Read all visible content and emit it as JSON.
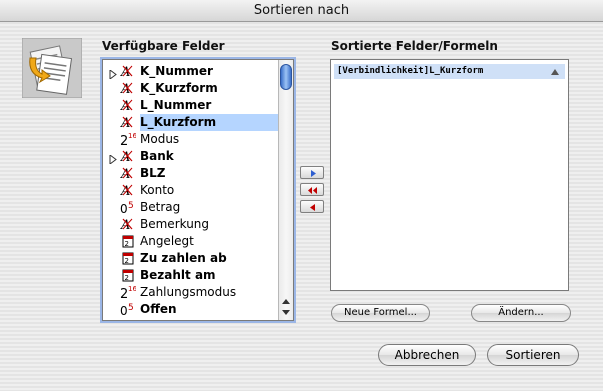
{
  "window": {
    "title": "Sortieren nach"
  },
  "fields": {
    "heading": "Verfügbare Felder",
    "items": [
      {
        "label": "K_Nummer",
        "icon": "A",
        "bold": true,
        "expandable": true,
        "selected": false
      },
      {
        "label": "K_Kurzform",
        "icon": "A",
        "bold": true,
        "expandable": false,
        "selected": false
      },
      {
        "label": "L_Nummer",
        "icon": "A",
        "bold": true,
        "expandable": false,
        "selected": false
      },
      {
        "label": "L_Kurzform",
        "icon": "A",
        "bold": true,
        "expandable": false,
        "selected": true
      },
      {
        "label": "Modus",
        "icon": "2¹⁶",
        "bold": false,
        "expandable": false,
        "selected": false
      },
      {
        "label": "Bank",
        "icon": "A",
        "bold": true,
        "expandable": true,
        "selected": false
      },
      {
        "label": "BLZ",
        "icon": "A",
        "bold": true,
        "expandable": false,
        "selected": false
      },
      {
        "label": "Konto",
        "icon": "A",
        "bold": false,
        "expandable": false,
        "selected": false
      },
      {
        "label": "Betrag",
        "icon": "0.5",
        "bold": false,
        "expandable": false,
        "selected": false
      },
      {
        "label": "Bemerkung",
        "icon": "A",
        "bold": false,
        "expandable": false,
        "selected": false
      },
      {
        "label": "Angelegt",
        "icon": "date",
        "bold": false,
        "expandable": false,
        "selected": false
      },
      {
        "label": "Zu zahlen ab",
        "icon": "date",
        "bold": true,
        "expandable": false,
        "selected": false
      },
      {
        "label": "Bezahlt am",
        "icon": "date",
        "bold": true,
        "expandable": false,
        "selected": false
      },
      {
        "label": "Zahlungsmodus",
        "icon": "2¹⁶",
        "bold": false,
        "expandable": false,
        "selected": false
      },
      {
        "label": "Offen",
        "icon": "0.5",
        "bold": true,
        "expandable": false,
        "selected": false
      }
    ]
  },
  "sorted": {
    "heading": "Sortierte Felder/Formeln",
    "items": [
      {
        "label": "[Verbindlichkeit]L_Kurzform",
        "direction": "ascending"
      }
    ]
  },
  "buttons": {
    "new_formula": "Neue Formel...",
    "change": "Ändern...",
    "cancel": "Abbrechen",
    "sort": "Sortieren"
  },
  "colors": {
    "accent": "#3a6fc9",
    "selection": "#b5d5ff",
    "numeric_icon_red": "#c00000"
  }
}
